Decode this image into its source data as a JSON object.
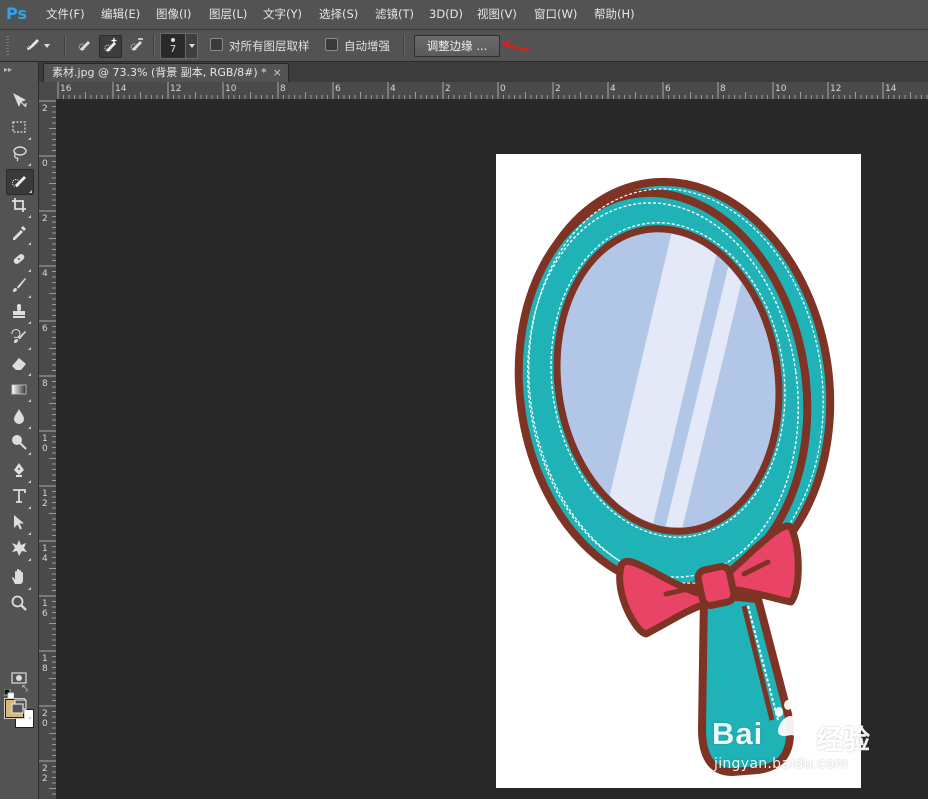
{
  "app": {
    "logo": "Ps",
    "menu": [
      {
        "label": "文件(F)"
      },
      {
        "label": "编辑(E)"
      },
      {
        "label": "图像(I)"
      },
      {
        "label": "图层(L)"
      },
      {
        "label": "文字(Y)"
      },
      {
        "label": "选择(S)"
      },
      {
        "label": "滤镜(T)"
      },
      {
        "label": "3D(D)"
      },
      {
        "label": "视图(V)"
      },
      {
        "label": "窗口(W)"
      },
      {
        "label": "帮助(H)"
      }
    ]
  },
  "options_bar": {
    "tool_preset_icon": "quick-selection-brush-icon",
    "modes": [
      {
        "name": "new-selection",
        "icon": "quick-select-new-icon",
        "active": false
      },
      {
        "name": "add-to-selection",
        "icon": "quick-select-add-icon",
        "active": true
      },
      {
        "name": "subtract-from-selection",
        "icon": "quick-select-subtract-icon",
        "active": false
      }
    ],
    "brush_size": "7",
    "sample_all_layers_label": "对所有图层取样",
    "auto_enhance_label": "自动增强",
    "refine_edge_label": "调整边缘 ..."
  },
  "document": {
    "tab_title": "素材.jpg @ 73.3% (背景 副本, RGB/8#) *",
    "close_glyph": "×"
  },
  "rulers": {
    "horizontal_labels": [
      "16",
      "14",
      "12",
      "10",
      "8",
      "6",
      "4",
      "2",
      "0",
      "2",
      "4",
      "6",
      "8",
      "10",
      "12",
      "14"
    ],
    "vertical_labels": [
      "2",
      "0",
      "2",
      "4",
      "6",
      "8",
      "10",
      "12",
      "14",
      "16",
      "18",
      "20",
      "22"
    ]
  },
  "tools": [
    {
      "name": "move-tool",
      "icon": "move-icon"
    },
    {
      "name": "marquee-tool",
      "icon": "rect-marquee-icon"
    },
    {
      "name": "lasso-tool",
      "icon": "lasso-icon"
    },
    {
      "name": "quick-selection-tool",
      "icon": "quick-selection-icon",
      "active": true
    },
    {
      "name": "crop-tool",
      "icon": "crop-icon"
    },
    {
      "name": "eyedropper-tool",
      "icon": "eyedropper-icon"
    },
    {
      "name": "healing-tool",
      "icon": "healing-brush-icon"
    },
    {
      "name": "brush-tool",
      "icon": "brush-icon"
    },
    {
      "name": "clone-stamp-tool",
      "icon": "stamp-icon"
    },
    {
      "name": "history-brush-tool",
      "icon": "history-brush-icon"
    },
    {
      "name": "eraser-tool",
      "icon": "eraser-icon"
    },
    {
      "name": "gradient-tool",
      "icon": "gradient-icon"
    },
    {
      "name": "blur-tool",
      "icon": "blur-drop-icon"
    },
    {
      "name": "dodge-tool",
      "icon": "dodge-icon"
    },
    {
      "name": "pen-tool",
      "icon": "pen-icon"
    },
    {
      "name": "type-tool",
      "icon": "type-icon"
    },
    {
      "name": "path-selection-tool",
      "icon": "path-select-arrow-icon"
    },
    {
      "name": "shape-tool",
      "icon": "custom-shape-icon"
    },
    {
      "name": "hand-tool",
      "icon": "hand-icon"
    },
    {
      "name": "zoom-tool",
      "icon": "zoom-icon"
    }
  ],
  "colors": {
    "foreground": "#d8b879",
    "background": "#ffffff",
    "accent": "#2ea3f2",
    "annotation_arrow": "#d91f1f"
  },
  "canvas_image": {
    "subject": "cartoon hand mirror with bow",
    "frame_color": "#1fb3b7",
    "outline_color": "#7f3324",
    "glass_color": "#b2c7e8",
    "bow_color": "#e94466",
    "selection": "marching-ants"
  },
  "watermark": {
    "brand": "Bai",
    "brand_cn": "经验",
    "url": "jingyan.baidu.com"
  }
}
